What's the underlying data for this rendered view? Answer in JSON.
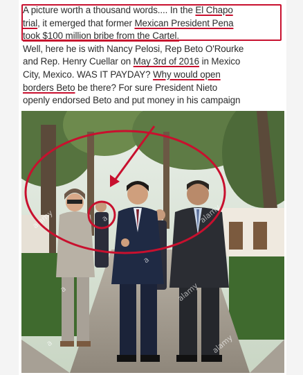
{
  "caption": {
    "line1_pre": "A picture worth a thousand words.... In the ",
    "line1_u": "El Chapo",
    "line2_u": "trial",
    "line2_post": ", it emerged that former ",
    "line2_u2": "Mexican President Pena",
    "line3_u": "took $100 million bribe from the Cartel.",
    "line4": "Well, here he is with Nancy Pelosi, Rep Beto O'Rourke",
    "line5": "and Rep. Henry Cuellar on ",
    "line5_u": "May 3rd of 2016",
    "line5_post": " in Mexico",
    "line6_pre": "City, Mexico. WAS IT PAYDAY? ",
    "line6_u": "Why would open",
    "line7_u": "borders Beto",
    "line7_post": " be there? For sure President Nieto",
    "line8": "openly endorsed Beto and put money in his campaign"
  },
  "photo": {
    "watermarks": [
      "alamy",
      "a",
      "alamy",
      "a",
      "alamy",
      "a",
      "a",
      "alamy"
    ]
  },
  "colors": {
    "annotation_red": "#c8102e",
    "text": "#2b2b2b",
    "background": "#ffffff"
  }
}
